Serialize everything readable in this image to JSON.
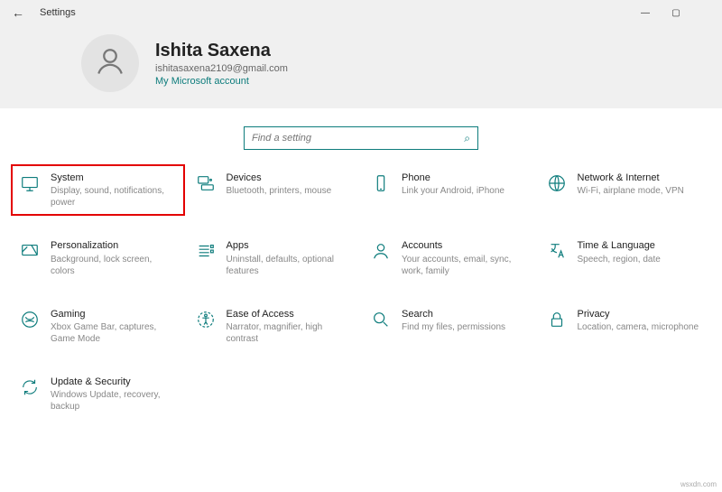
{
  "window": {
    "title": "Settings",
    "back_glyph": "←",
    "min_glyph": "—",
    "max_glyph": "▢",
    "close_glyph": ""
  },
  "user": {
    "name": "Ishita Saxena",
    "email": "ishitasaxena2109@gmail.com",
    "ms_link": "My Microsoft account"
  },
  "search": {
    "placeholder": "Find a setting",
    "glyph": "⌕"
  },
  "tiles": {
    "system": {
      "label": "System",
      "desc": "Display, sound, notifications, power"
    },
    "devices": {
      "label": "Devices",
      "desc": "Bluetooth, printers, mouse"
    },
    "phone": {
      "label": "Phone",
      "desc": "Link your Android, iPhone"
    },
    "network": {
      "label": "Network & Internet",
      "desc": "Wi-Fi, airplane mode, VPN"
    },
    "personal": {
      "label": "Personalization",
      "desc": "Background, lock screen, colors"
    },
    "apps": {
      "label": "Apps",
      "desc": "Uninstall, defaults, optional features"
    },
    "accounts": {
      "label": "Accounts",
      "desc": "Your accounts, email, sync, work, family"
    },
    "time": {
      "label": "Time & Language",
      "desc": "Speech, region, date"
    },
    "gaming": {
      "label": "Gaming",
      "desc": "Xbox Game Bar, captures, Game Mode"
    },
    "ease": {
      "label": "Ease of Access",
      "desc": "Narrator, magnifier, high contrast"
    },
    "searchtile": {
      "label": "Search",
      "desc": "Find my files, permissions"
    },
    "privacy": {
      "label": "Privacy",
      "desc": "Location, camera, microphone"
    },
    "update": {
      "label": "Update & Security",
      "desc": "Windows Update, recovery, backup"
    }
  },
  "watermark": "wsxdn.com"
}
